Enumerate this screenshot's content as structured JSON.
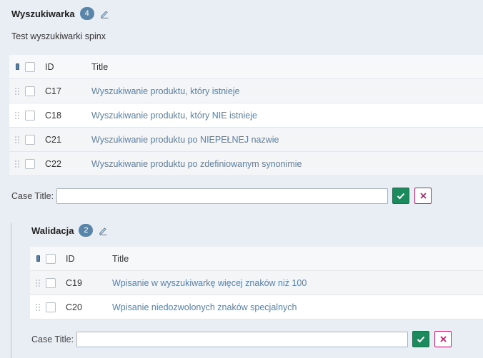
{
  "sections": [
    {
      "title": "Wyszukiwarka",
      "count": "4",
      "description": "Test wyszukiwarki spinx",
      "columns": {
        "id": "ID",
        "title": "Title"
      },
      "rows": [
        {
          "id": "C17",
          "title": "Wyszukiwanie produktu, który istnieje"
        },
        {
          "id": "C18",
          "title": "Wyszukiwanie produktu, który NIE istnieje"
        },
        {
          "id": "C21",
          "title": "Wyszukiwanie produktu po NIEPEŁNEJ nazwie"
        },
        {
          "id": "C22",
          "title": "Wyszukiwanie produktu po zdefiniowanym synonimie"
        }
      ],
      "case_form": {
        "label": "Case Title:",
        "value": ""
      }
    },
    {
      "title": "Walidacja",
      "count": "2",
      "columns": {
        "id": "ID",
        "title": "Title"
      },
      "rows": [
        {
          "id": "C19",
          "title": "Wpisanie w wyszukiwarkę więcej znaków niż 100"
        },
        {
          "id": "C20",
          "title": "Wpisanie niedozwolonych znaków specjalnych"
        }
      ],
      "case_form": {
        "label": "Case Title:",
        "value": ""
      }
    }
  ],
  "icons": {
    "edit": "pencil-icon",
    "drag": "drag-handle-icon",
    "confirm": "check-icon",
    "cancel": "close-icon"
  },
  "colors": {
    "badge": "#5b85a8",
    "link": "#5b80a6",
    "confirm": "#1d8a5e",
    "cancel": "#c0256b"
  }
}
